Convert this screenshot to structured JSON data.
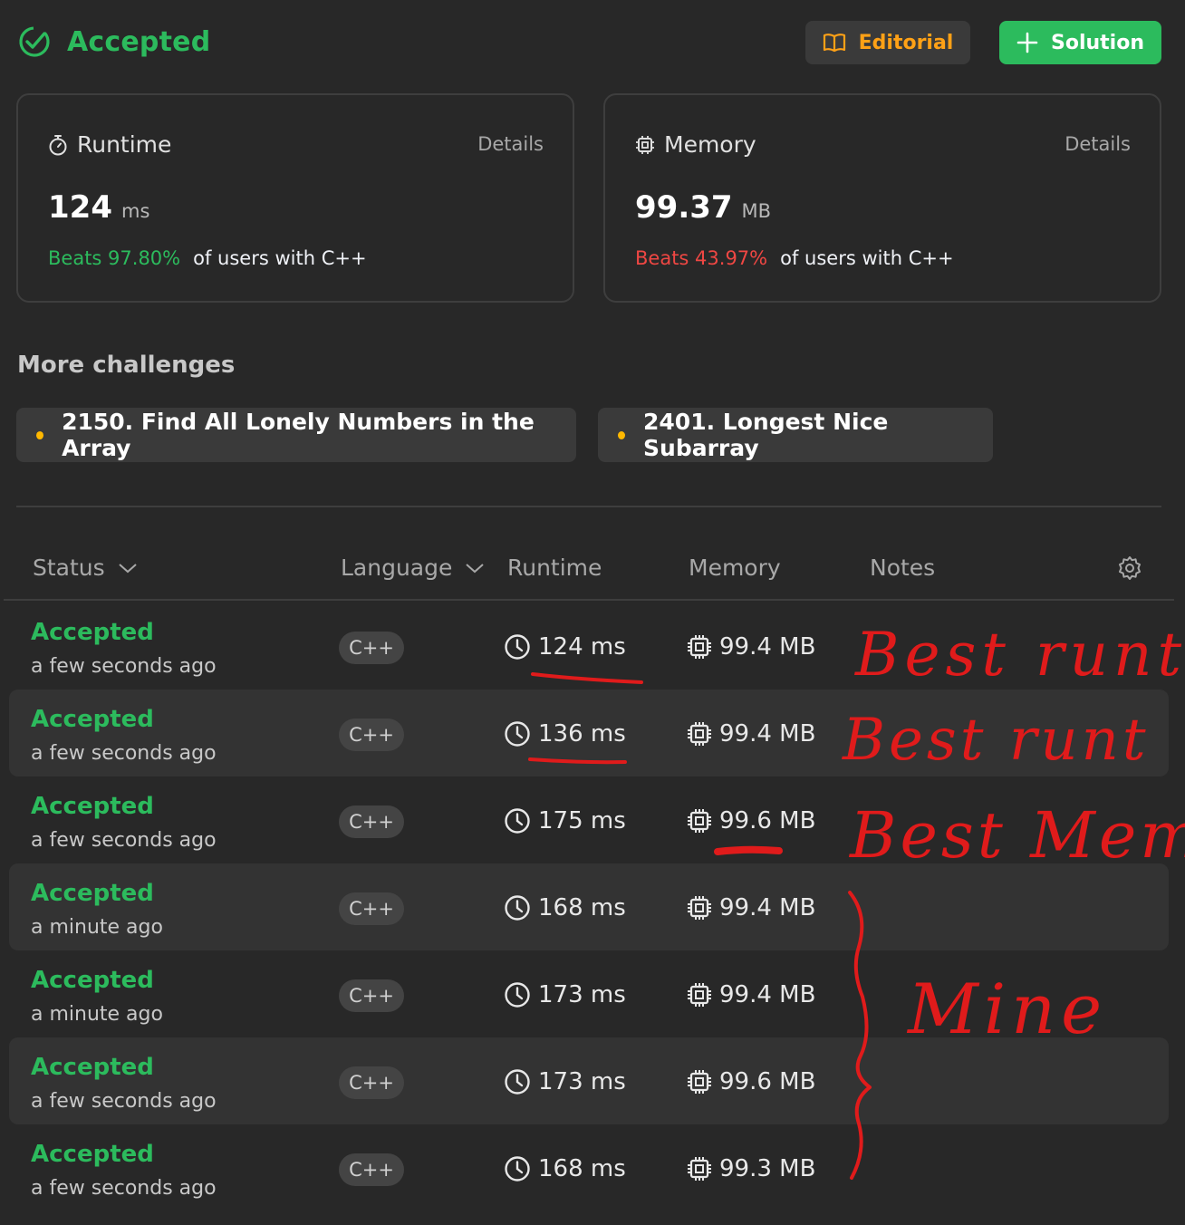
{
  "header": {
    "status": "Accepted",
    "editorial_label": "Editorial",
    "solution_label": "Solution"
  },
  "runtime_card": {
    "label": "Runtime",
    "details": "Details",
    "value": "124",
    "unit": "ms",
    "beats": "Beats 97.80%",
    "rest": "of users with C++"
  },
  "memory_card": {
    "label": "Memory",
    "details": "Details",
    "value": "99.37",
    "unit": "MB",
    "beats": "Beats 43.97%",
    "rest": "of users with C++"
  },
  "more": {
    "title": "More challenges",
    "items": [
      {
        "label": "2150. Find All Lonely Numbers in the Array"
      },
      {
        "label": "2401. Longest Nice Subarray"
      }
    ]
  },
  "table": {
    "headers": {
      "status": "Status",
      "language": "Language",
      "runtime": "Runtime",
      "memory": "Memory",
      "notes": "Notes"
    },
    "rows": [
      {
        "status": "Accepted",
        "time": "a few seconds ago",
        "lang": "C++",
        "runtime": "124 ms",
        "memory": "99.4 MB"
      },
      {
        "status": "Accepted",
        "time": "a few seconds ago",
        "lang": "C++",
        "runtime": "136 ms",
        "memory": "99.4 MB"
      },
      {
        "status": "Accepted",
        "time": "a few seconds ago",
        "lang": "C++",
        "runtime": "175 ms",
        "memory": "99.6 MB"
      },
      {
        "status": "Accepted",
        "time": "a minute ago",
        "lang": "C++",
        "runtime": "168 ms",
        "memory": "99.4 MB"
      },
      {
        "status": "Accepted",
        "time": "a minute ago",
        "lang": "C++",
        "runtime": "173 ms",
        "memory": "99.4 MB"
      },
      {
        "status": "Accepted",
        "time": "a few seconds ago",
        "lang": "C++",
        "runtime": "173 ms",
        "memory": "99.6 MB"
      },
      {
        "status": "Accepted",
        "time": "a few seconds ago",
        "lang": "C++",
        "runtime": "168 ms",
        "memory": "99.3 MB"
      }
    ]
  },
  "annotations": {
    "note_1": "Best runt",
    "note_2": "Best runt",
    "note_3": "Best Mem",
    "note_4": "Mine"
  },
  "colors": {
    "accent_green": "#2cbb5d",
    "accent_orange": "#ffa116",
    "bad_red": "#ef4743",
    "annotation_red": "#e01b1b",
    "background": "#282828"
  },
  "icons": [
    "check-circle-icon",
    "book-icon",
    "plus-icon",
    "stopwatch-icon",
    "chip-icon",
    "chevron-down-icon",
    "gear-icon",
    "clock-icon"
  ]
}
